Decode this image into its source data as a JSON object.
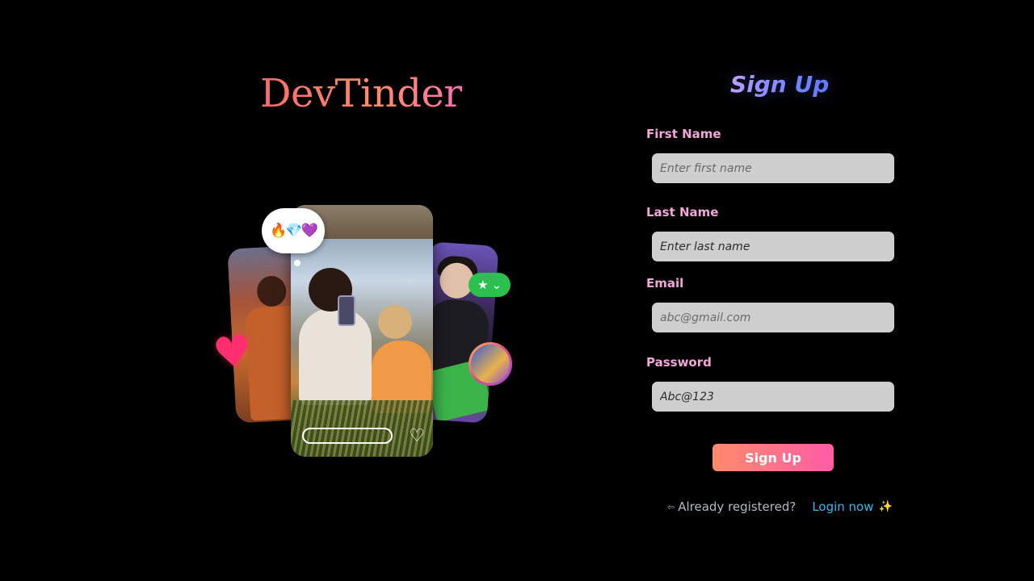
{
  "brand": {
    "name": "DevTinder"
  },
  "illustration": {
    "bubble_emojis": "🔥💎💜",
    "star_badge": "★",
    "star_chevron": "⌄",
    "heart_icon": "♥",
    "heart_outline_icon": "♡"
  },
  "form": {
    "title": "Sign Up",
    "fields": [
      {
        "label": "First Name",
        "placeholder": "Enter first name",
        "type": "text"
      },
      {
        "label": "Last Name",
        "placeholder": "Enter last name",
        "type": "text"
      },
      {
        "label": "Email",
        "placeholder": "abc@gmail.com",
        "type": "email"
      },
      {
        "label": "Password",
        "placeholder": "Abc@123",
        "type": "password"
      }
    ],
    "submit_label": "Sign Up"
  },
  "footer": {
    "prompt": "Already registered?",
    "login_link": "Login now",
    "exit_icon": "⇦",
    "sparkle_icon": "✨"
  },
  "colors": {
    "background": "#000000",
    "label": "#f0a6d6",
    "field_bg": "#cfcfcf",
    "link": "#38b6f0",
    "button_from": "#ff8a6a",
    "button_to": "#ff5ca8"
  }
}
